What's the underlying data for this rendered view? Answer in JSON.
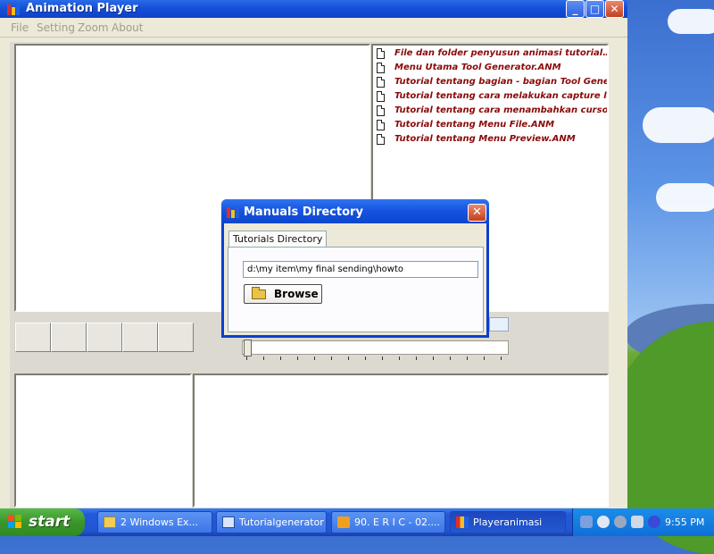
{
  "window": {
    "title": "Animation Player"
  },
  "titlebar_buttons": {
    "minimize": "_",
    "maximize": "□",
    "close": "✕"
  },
  "menu": [
    {
      "label": "File"
    },
    {
      "label": "Setting"
    },
    {
      "label": "Zoom"
    },
    {
      "label": "About"
    }
  ],
  "file_list": [
    "File dan folder penyusun animasi tutorial.AN",
    "Menu Utama Tool Generator.ANM",
    "Tutorial tentang bagian - bagian Tool Gener",
    "Tutorial tentang cara melakukan capture lay",
    "Tutorial tentang cara menambahkan cursor p",
    "Tutorial tentang Menu File.ANM",
    "Tutorial tentang Menu Preview.ANM"
  ],
  "dialog": {
    "title": "Manuals Directory",
    "close": "✕",
    "tab": "Tutorials Directory",
    "path_value": "d:\\my item\\my final sending\\howto",
    "browse_label": "Browse"
  },
  "taskbar": {
    "start_label": "start",
    "tasks": [
      {
        "label": "2 Windows Ex...",
        "icon": "folder-icon"
      },
      {
        "label": "Tutorialgenerator",
        "icon": "app-window-icon"
      },
      {
        "label": "90. E R I C - 02....",
        "icon": "media-icon"
      },
      {
        "label": "Playeranimasi",
        "icon": "player-icon"
      }
    ],
    "clock": "9:55 PM"
  },
  "colors": {
    "titlebar_blue": "#1450d8",
    "file_text": "#8a0a0a",
    "start_green": "#3a962b"
  }
}
